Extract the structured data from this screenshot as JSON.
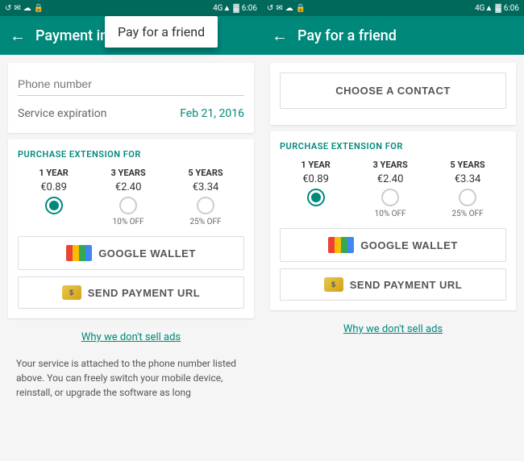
{
  "panels": [
    {
      "id": "left",
      "statusBar": {
        "leftIcons": [
          "↺",
          "✉",
          "☁",
          "🔒"
        ],
        "network": "4G▲",
        "battery": "█",
        "time": "6:06"
      },
      "header": {
        "backLabel": "←",
        "title": "Payment in...",
        "hasTooltip": true,
        "tooltipText": "Pay for a friend"
      },
      "phoneLabel": "Phone number",
      "serviceLabel": "Service expiration",
      "serviceDate": "Feb 21, 2016",
      "purchaseSectionTitle": "PURCHASE EXTENSION FOR",
      "purchaseOptions": [
        {
          "years": "1 YEAR",
          "price": "€0.89",
          "discount": "",
          "selected": true
        },
        {
          "years": "3 YEARS",
          "price": "€2.40",
          "discount": "10% OFF",
          "selected": false
        },
        {
          "years": "5 YEARS",
          "price": "€3.34",
          "discount": "25% OFF",
          "selected": false
        }
      ],
      "googleWalletLabel": "GOOGLE WALLET",
      "sendPaymentLabel": "SEND PAYMENT URL",
      "whyAdsLink": "Why we don't sell ads",
      "description": "Your service is attached to the phone number listed above. You can freely switch your mobile device, reinstall, or upgrade the software as long"
    },
    {
      "id": "right",
      "statusBar": {
        "leftIcons": [
          "↺",
          "✉",
          "☁",
          "🔒"
        ],
        "network": "4G▲",
        "battery": "█",
        "time": "6:06"
      },
      "header": {
        "backLabel": "←",
        "title": "Pay for a friend"
      },
      "chooseContactLabel": "CHOOSE A CONTACT",
      "purchaseSectionTitle": "PURCHASE EXTENSION FOR",
      "purchaseOptions": [
        {
          "years": "1 YEAR",
          "price": "€0.89",
          "discount": "",
          "selected": true
        },
        {
          "years": "3 YEARS",
          "price": "€2.40",
          "discount": "10% OFF",
          "selected": false
        },
        {
          "years": "5 YEARS",
          "price": "€3.34",
          "discount": "25% OFF",
          "selected": false
        }
      ],
      "googleWalletLabel": "GOOGLE WALLET",
      "sendPaymentLabel": "SEND PAYMENT URL",
      "whyAdsLink": "Why we don't sell ads"
    }
  ]
}
